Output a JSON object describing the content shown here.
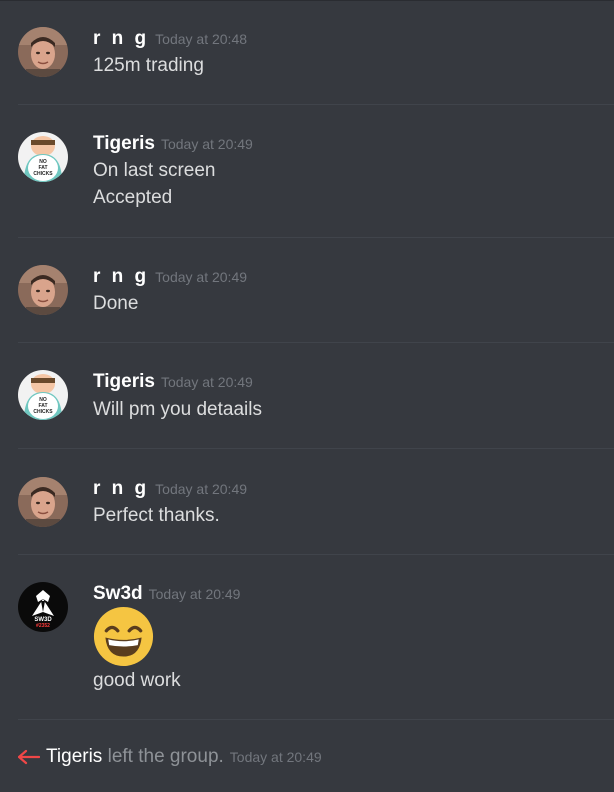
{
  "messages": [
    {
      "author": "r n g",
      "time": "Today at 20:48",
      "lines": [
        "125m trading"
      ],
      "avatar": "rng-avatar"
    },
    {
      "author": "Tigeris",
      "time": "Today at 20:49",
      "lines": [
        "On last screen",
        "Accepted"
      ],
      "avatar": "tigeris-avatar",
      "avatar_text": [
        "NO",
        "FAT",
        "CHICKS"
      ]
    },
    {
      "author": "r n g",
      "time": "Today at 20:49",
      "lines": [
        "Done"
      ],
      "avatar": "rng-avatar"
    },
    {
      "author": "Tigeris",
      "time": "Today at 20:49",
      "lines": [
        "Will pm you detaails"
      ],
      "avatar": "tigeris-avatar",
      "avatar_text": [
        "NO",
        "FAT",
        "CHICKS"
      ]
    },
    {
      "author": "r n g",
      "time": "Today at 20:49",
      "lines": [
        "Perfect thanks."
      ],
      "avatar": "rng-avatar"
    },
    {
      "author": "Sw3d",
      "time": "Today at 20:49",
      "emoji": "grinning-face-emoji",
      "lines": [
        "good work"
      ],
      "avatar": "sw3d-avatar",
      "avatar_text": [
        "SW3D",
        "#2352"
      ]
    }
  ],
  "system": {
    "icon": "left-arrow-icon",
    "user": "Tigeris",
    "text": "left the group.",
    "time": "Today at 20:49"
  },
  "colors": {
    "background": "#36393f",
    "author": "#ffffff",
    "text": "#dcddde",
    "timestamp": "#72767d",
    "leave_arrow": "#f04747"
  }
}
